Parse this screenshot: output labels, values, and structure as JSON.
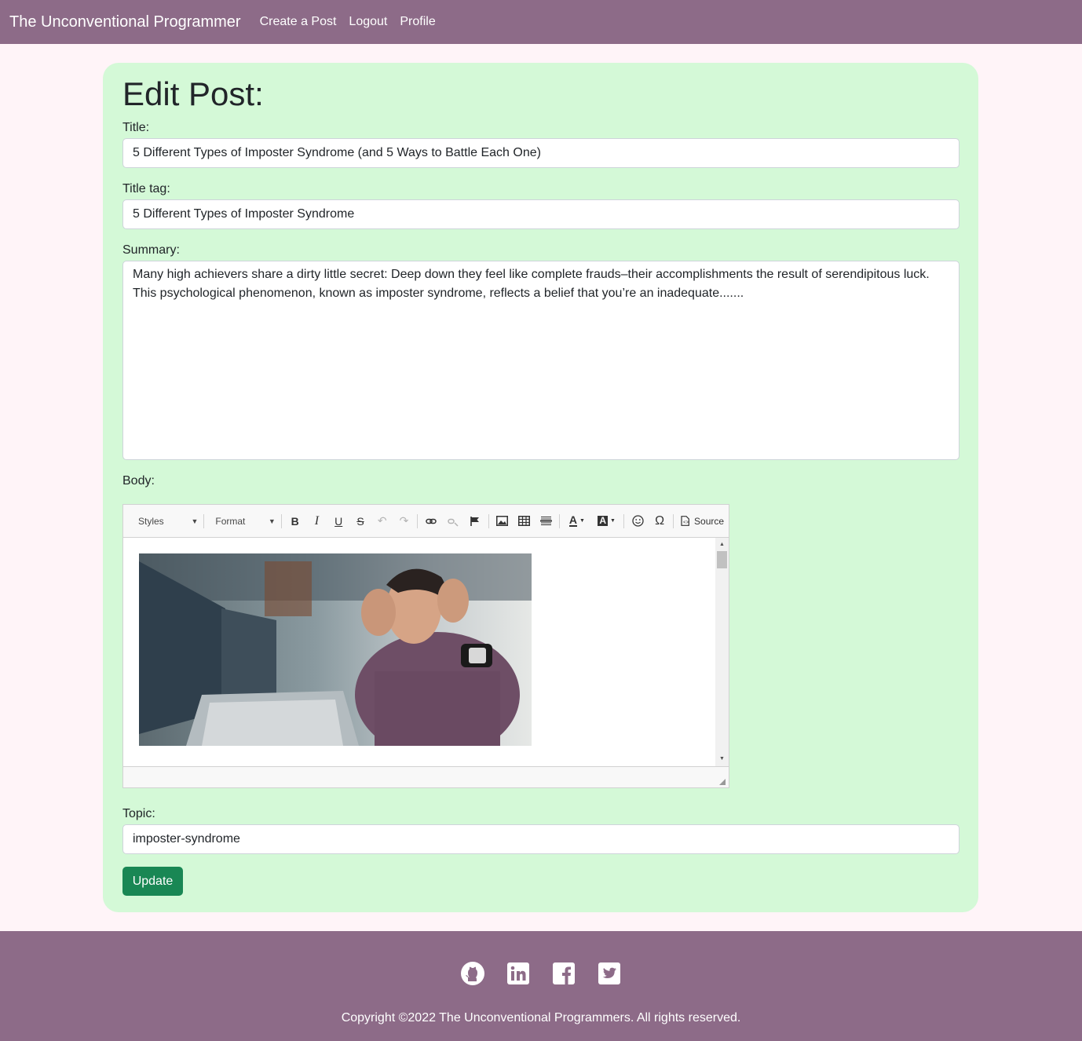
{
  "nav": {
    "brand": "The Unconventional Programmer",
    "links": [
      "Create a Post",
      "Logout",
      "Profile"
    ]
  },
  "form": {
    "heading": "Edit Post:",
    "title_label": "Title:",
    "title_value": "5 Different Types of Imposter Syndrome (and 5 Ways to Battle Each One)",
    "title_tag_label": "Title tag:",
    "title_tag_value": "5 Different Types of Imposter Syndrome",
    "summary_label": "Summary:",
    "summary_value": "Many high achievers share a dirty little secret: Deep down they feel like complete frauds–their accomplishments the result of serendipitous luck. This psychological phenomenon, known as imposter syndrome, reflects a belief that you’re an inadequate.......",
    "body_label": "Body:",
    "topic_label": "Topic:",
    "topic_value": "imposter-syndrome",
    "submit_label": "Update"
  },
  "editor": {
    "styles_label": "Styles",
    "format_label": "Format",
    "source_label": "Source",
    "toolbar_icons": [
      "bold-icon",
      "italic-icon",
      "underline-icon",
      "strikethrough-icon",
      "undo-icon",
      "redo-icon",
      "link-icon",
      "unlink-icon",
      "anchor-icon",
      "image-icon",
      "table-icon",
      "horizontal-line-icon",
      "text-color-icon",
      "background-color-icon",
      "smiley-icon",
      "special-char-icon",
      "source-icon"
    ],
    "image_alt": "Man at computer holding his head"
  },
  "footer": {
    "copyright": "Copyright ©2022 The Unconventional Programmers. All rights reserved.",
    "social_icons": [
      "github-icon",
      "linkedin-icon",
      "facebook-icon",
      "twitter-icon"
    ]
  },
  "colors": {
    "navbar": "#8d6b88",
    "page_bg": "#fff4f8",
    "card_bg": "#d4f9d7",
    "button": "#198754"
  }
}
